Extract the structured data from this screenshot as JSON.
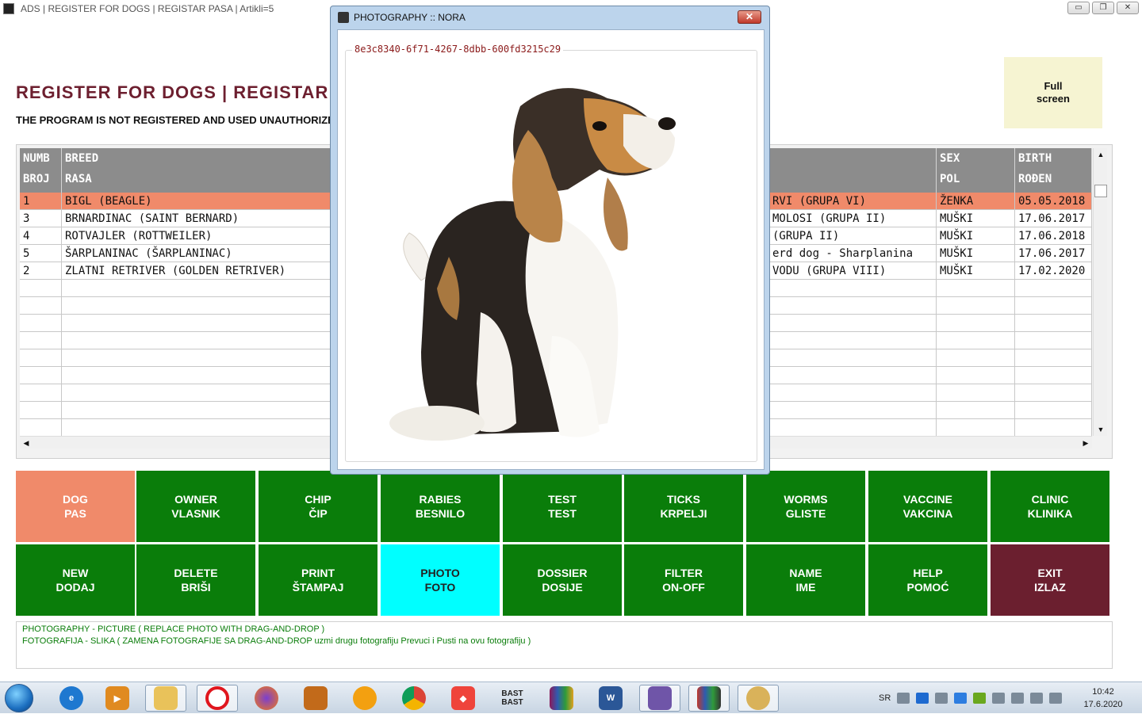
{
  "window": {
    "title": "ADS | REGISTER FOR DOGS | REGISTAR PASA | Artikli=5",
    "minimize": "▭",
    "maximize": "❐",
    "close": "✕"
  },
  "heading": "REGISTER FOR DOGS | REGISTAR",
  "warning": "THE PROGRAM IS NOT REGISTERED AND USED UNAUTHORIZED",
  "fullscreen": {
    "line1": "Full",
    "line2": "screen"
  },
  "grid": {
    "columns": [
      {
        "en": "NUMB",
        "local": "BROJ"
      },
      {
        "en": "BREED",
        "local": "RASA"
      },
      {
        "en": "",
        "local": ""
      },
      {
        "en": "SEX",
        "local": "POL"
      },
      {
        "en": "BIRTH",
        "local": "ROĐEN"
      }
    ],
    "rows": [
      {
        "num": "1",
        "breed": "BIGL (BEAGLE)",
        "group": "RVI (GRUPA VI)",
        "sex": "ŽENKA",
        "birth": "05.05.2018"
      },
      {
        "num": "3",
        "breed": "BRNARDINAC (SAINT BERNARD)",
        "group": "MOLOSI (GRUPA II)",
        "sex": "MUŠKI",
        "birth": "17.06.2017"
      },
      {
        "num": "4",
        "breed": "ROTVAJLER (ROTTWEILER)",
        "group": " (GRUPA II)",
        "sex": "MUŠKI",
        "birth": "17.06.2018"
      },
      {
        "num": "5",
        "breed": "ŠARPLANINAC (ŠARPLANINAC)",
        "group": "erd dog - Sharplanina",
        "sex": "MUŠKI",
        "birth": "17.06.2017"
      },
      {
        "num": "2",
        "breed": "ZLATNI RETRIVER (GOLDEN RETRIVER)",
        "group": " VODU (GRUPA VIII)",
        "sex": "MUŠKI",
        "birth": "17.02.2020"
      }
    ]
  },
  "buttons_row1": [
    {
      "l1": "DOG",
      "l2": "PAS"
    },
    {
      "l1": "OWNER",
      "l2": "VLASNIK"
    },
    {
      "l1": "CHIP",
      "l2": "ČIP"
    },
    {
      "l1": "RABIES",
      "l2": "BESNILO"
    },
    {
      "l1": "TEST",
      "l2": "TEST"
    },
    {
      "l1": "TICKS",
      "l2": "KRPELJI"
    },
    {
      "l1": "WORMS",
      "l2": "GLISTE"
    },
    {
      "l1": "VACCINE",
      "l2": "VAKCINA"
    },
    {
      "l1": "CLINIC",
      "l2": "KLINIKA"
    }
  ],
  "buttons_row2": [
    {
      "l1": "NEW",
      "l2": "DODAJ"
    },
    {
      "l1": "DELETE",
      "l2": "BRIŠI"
    },
    {
      "l1": "PRINT",
      "l2": "ŠTAMPAJ"
    },
    {
      "l1": "PHOTO",
      "l2": "FOTO"
    },
    {
      "l1": "DOSSIER",
      "l2": "DOSIJE"
    },
    {
      "l1": "FILTER",
      "l2": "ON-OFF"
    },
    {
      "l1": "NAME",
      "l2": "IME"
    },
    {
      "l1": "HELP",
      "l2": "POMOĆ"
    },
    {
      "l1": "EXIT",
      "l2": "IZLAZ"
    }
  ],
  "info": {
    "line1": "PHOTOGRAPHY - PICTURE  ( REPLACE PHOTO WITH DRAG-AND-DROP )",
    "line2": "FOTOGRAFIJA - SLIKA  ( ZAMENA FOTOGRAFIJE SA DRAG-AND-DROP uzmi drugu fotografiju Prevuci i Pusti na ovu fotografiju )"
  },
  "photo_dialog": {
    "title": "PHOTOGRAPHY :: NORA",
    "close": "✕",
    "guid": "8e3c8340-6f71-4267-8dbb-600fd3215c29"
  },
  "taskbar": {
    "lang": "SR",
    "time": "10:42",
    "date": "17.6.2020",
    "bast": "BAST BAST"
  },
  "colors": {
    "green_button": "#0a7d0a",
    "dog_button": "#f08a6a",
    "photo_button": "#00ffff",
    "exit_button": "#6b1f2f",
    "heading": "#6d1f2f",
    "selected_row": "#f08a6a",
    "grid_header": "#8c8c8c"
  }
}
